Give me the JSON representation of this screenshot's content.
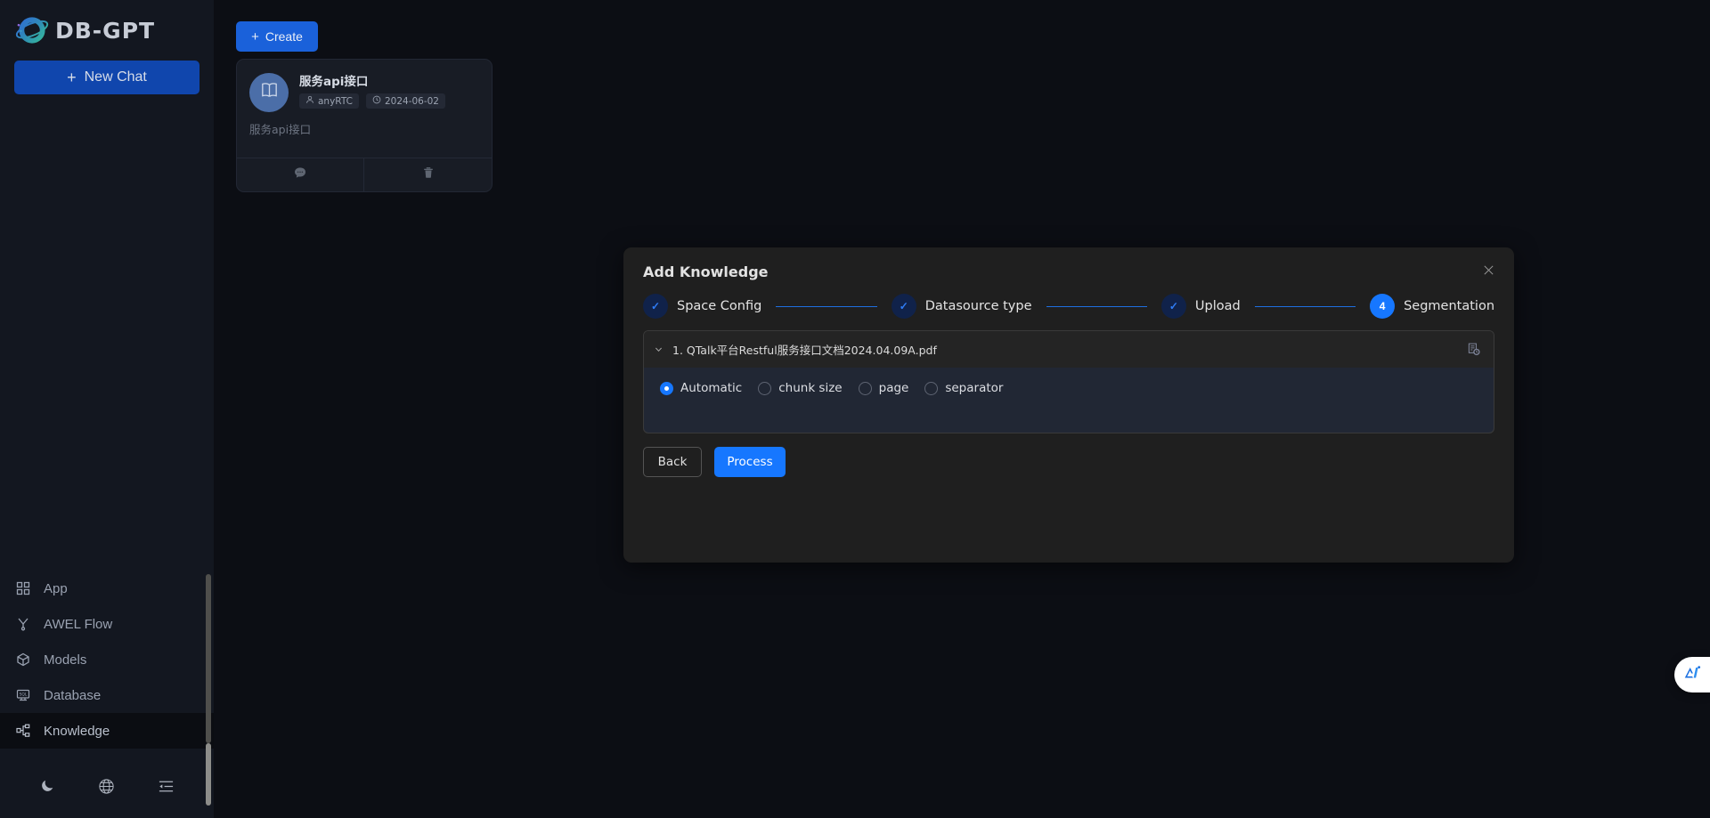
{
  "brand": {
    "name": "DB-GPT",
    "logo_icon": "planet-logo-icon"
  },
  "sidebar": {
    "new_chat_label": "New Chat",
    "items": [
      {
        "label": "App",
        "icon": "grid-icon",
        "active": false
      },
      {
        "label": "AWEL Flow",
        "icon": "flow-icon",
        "active": false
      },
      {
        "label": "Models",
        "icon": "cube-icon",
        "active": false
      },
      {
        "label": "Database",
        "icon": "database-icon",
        "active": false
      },
      {
        "label": "Knowledge",
        "icon": "knowledge-icon",
        "active": true
      }
    ],
    "bottom_icons": [
      {
        "name": "moon-icon"
      },
      {
        "name": "globe-icon"
      },
      {
        "name": "menu-fold-icon"
      }
    ]
  },
  "main": {
    "create_label": "Create",
    "card": {
      "title": "服务api接口",
      "owner": "anyRTC",
      "owner_icon": "user-icon",
      "date": "2024-06-02",
      "date_icon": "clock-icon",
      "description": "服务api接口",
      "avatar_icon": "book-icon",
      "actions": [
        {
          "name": "chat-icon"
        },
        {
          "name": "delete-icon"
        }
      ]
    }
  },
  "modal": {
    "title": "Add Knowledge",
    "close_icon": "close-icon",
    "steps": [
      {
        "label": "Space Config",
        "marker": "✓",
        "state": "done"
      },
      {
        "label": "Datasource type",
        "marker": "✓",
        "state": "done"
      },
      {
        "label": "Upload",
        "marker": "✓",
        "state": "done"
      },
      {
        "label": "Segmentation",
        "marker": "4",
        "state": "current"
      }
    ],
    "file": {
      "name": "1. QTalk平台Restful服务接口文档2024.04.09A.pdf",
      "chevron_icon": "chevron-down-icon",
      "detail_icon": "document-clock-icon"
    },
    "segmentation_options": [
      {
        "label": "Automatic",
        "selected": true
      },
      {
        "label": "chunk size",
        "selected": false
      },
      {
        "label": "page",
        "selected": false
      },
      {
        "label": "separator",
        "selected": false
      }
    ],
    "back_label": "Back",
    "process_label": "Process"
  },
  "float": {
    "ai_icon": "ai-assistant-icon"
  },
  "colors": {
    "accent": "#1677ff",
    "sidebar_bg": "#131720",
    "page_bg": "#0c0e14",
    "modal_bg": "#1f1f1f",
    "seg_panel_bg": "#212734",
    "new_chat_bg": "#1046ad"
  }
}
